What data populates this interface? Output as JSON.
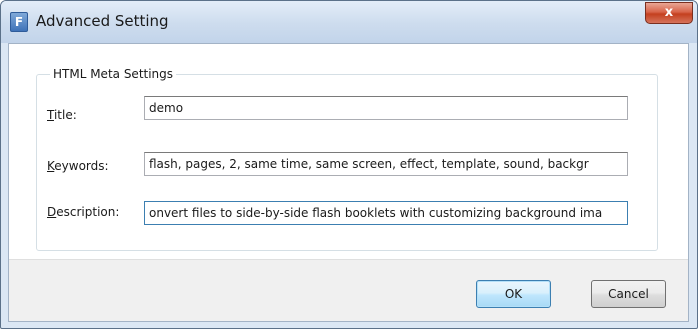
{
  "window": {
    "title": "Advanced Setting",
    "app_icon_letter": "F",
    "close_symbol": "x"
  },
  "group": {
    "legend": "HTML Meta Settings"
  },
  "fields": {
    "title": {
      "label_accel": "T",
      "label_rest": "itle:",
      "value": "demo"
    },
    "keywords": {
      "label_accel": "K",
      "label_rest": "eywords:",
      "value": "flash, pages, 2, same time, same screen, effect, template, sound, backgr"
    },
    "description": {
      "label_accel": "D",
      "label_rest": "escription:",
      "value": "onvert files to side-by-side flash booklets with customizing background ima"
    }
  },
  "buttons": {
    "ok_label": "OK",
    "cancel_label": "Cancel"
  },
  "colors": {
    "default_button_border": "#3c7fb1",
    "close_button": "#c4401f",
    "titlebar": "#cddcee"
  }
}
